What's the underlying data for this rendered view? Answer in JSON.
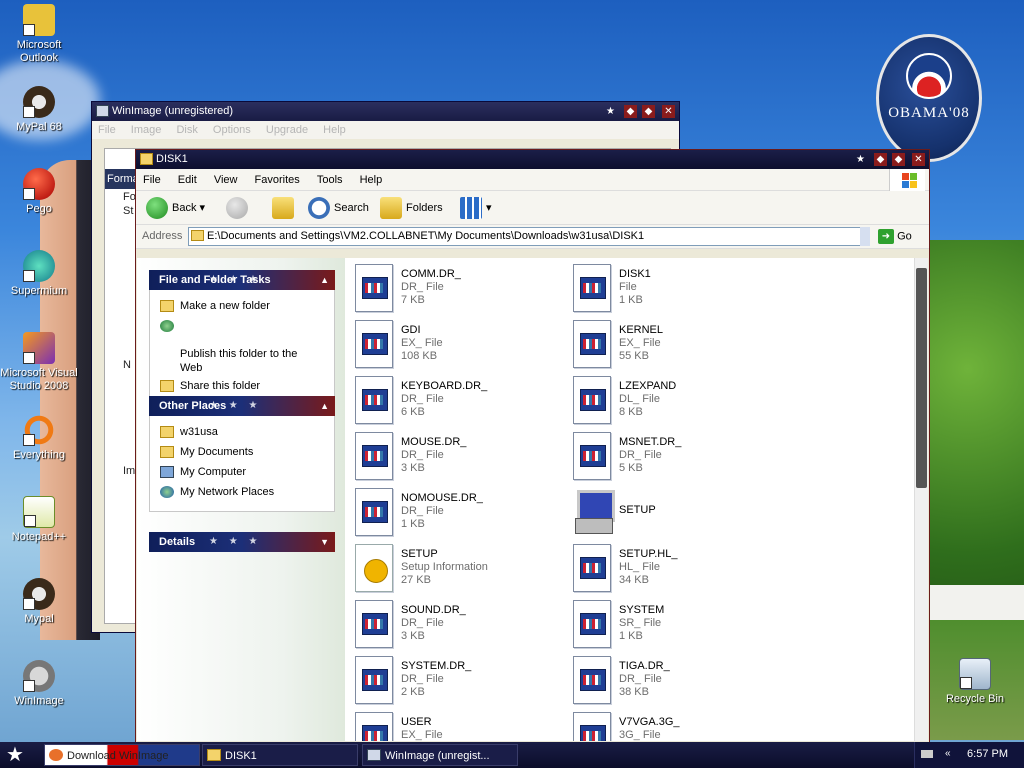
{
  "desktop": {
    "icons": [
      {
        "label": "Microsoft\nOutlook",
        "icon": "outlook-icon"
      },
      {
        "label": "MyPal 68",
        "icon": "mypal-icon"
      },
      {
        "label": "Pego",
        "icon": "pego-icon"
      },
      {
        "label": "Supermium",
        "icon": "supermium-icon"
      },
      {
        "label": "Microsoft Visual\nStudio 2008",
        "icon": "visual-studio-icon"
      },
      {
        "label": "Everything",
        "icon": "everything-icon"
      },
      {
        "label": "Notepad++",
        "icon": "notepadpp-icon"
      },
      {
        "label": "Mypal",
        "icon": "mypal-icon"
      },
      {
        "label": "WinImage",
        "icon": "winimage-icon"
      }
    ],
    "recycle_bin": "Recycle Bin",
    "badge": {
      "text": "OBAMA'08"
    }
  },
  "winimage_window": {
    "title": "WinImage (unregistered)",
    "menu": [
      "File",
      "Image",
      "Disk",
      "Options",
      "Upgrade",
      "Help"
    ],
    "strip_label": "Forma",
    "ghost_labels": [
      "Fo",
      "St",
      "N",
      "Im"
    ]
  },
  "explorer": {
    "title": "DISK1",
    "menu": [
      "File",
      "Edit",
      "View",
      "Favorites",
      "Tools",
      "Help"
    ],
    "toolbar": {
      "back": "Back",
      "search": "Search",
      "folders": "Folders"
    },
    "address": {
      "label": "Address",
      "path": "E:\\Documents and Settings\\VM2.COLLABNET\\My Documents\\Downloads\\w31usa\\DISK1",
      "go": "Go"
    },
    "task_panels": {
      "file_tasks": {
        "header": "File and Folder Tasks",
        "items": [
          "Make a new folder",
          "Publish this folder to the\nWeb",
          "Share this folder"
        ]
      },
      "other_places": {
        "header": "Other Places",
        "items": [
          "w31usa",
          "My Documents",
          "My Computer",
          "My Network Places"
        ]
      },
      "details": {
        "header": "Details"
      }
    },
    "files": [
      {
        "name": "COMM.DR_",
        "type": "DR_ File",
        "size": "7 KB",
        "kind": "generic"
      },
      {
        "name": "DISK1",
        "type": "File",
        "size": "1 KB",
        "kind": "generic"
      },
      {
        "name": "GDI",
        "type": "EX_ File",
        "size": "108 KB",
        "kind": "generic"
      },
      {
        "name": "KERNEL",
        "type": "EX_ File",
        "size": "55 KB",
        "kind": "generic"
      },
      {
        "name": "KEYBOARD.DR_",
        "type": "DR_ File",
        "size": "6 KB",
        "kind": "generic"
      },
      {
        "name": "LZEXPAND",
        "type": "DL_ File",
        "size": "8 KB",
        "kind": "generic"
      },
      {
        "name": "MOUSE.DR_",
        "type": "DR_ File",
        "size": "3 KB",
        "kind": "generic"
      },
      {
        "name": "MSNET.DR_",
        "type": "DR_ File",
        "size": "5 KB",
        "kind": "generic"
      },
      {
        "name": "NOMOUSE.DR_",
        "type": "DR_ File",
        "size": "1 KB",
        "kind": "generic"
      },
      {
        "name": "SETUP",
        "type": "",
        "size": "",
        "kind": "exe"
      },
      {
        "name": "SETUP",
        "type": "Setup Information",
        "size": "27 KB",
        "kind": "inf"
      },
      {
        "name": "SETUP.HL_",
        "type": "HL_ File",
        "size": "34 KB",
        "kind": "generic"
      },
      {
        "name": "SOUND.DR_",
        "type": "DR_ File",
        "size": "3 KB",
        "kind": "generic"
      },
      {
        "name": "SYSTEM",
        "type": "SR_ File",
        "size": "1 KB",
        "kind": "generic"
      },
      {
        "name": "SYSTEM.DR_",
        "type": "DR_ File",
        "size": "2 KB",
        "kind": "generic"
      },
      {
        "name": "TIGA.DR_",
        "type": "DR_ File",
        "size": "38 KB",
        "kind": "generic"
      },
      {
        "name": "USER",
        "type": "EX_ File",
        "size": "",
        "kind": "generic"
      },
      {
        "name": "V7VGA.3G_",
        "type": "3G_ File",
        "size": "",
        "kind": "generic"
      }
    ]
  },
  "taskbar": {
    "buttons": [
      {
        "label": "Download WinImage",
        "icon": "firefox-icon"
      },
      {
        "label": "DISK1",
        "icon": "folder-icon"
      },
      {
        "label": "WinImage (unregist...",
        "icon": "winimage-icon"
      }
    ],
    "clock": "6:57 PM"
  },
  "colors": {
    "title_bar": "#13163a",
    "explorer_border": "#6a1b1b",
    "task_header_blue": "#0f1f5a",
    "task_header_red": "#7a1a1a"
  }
}
